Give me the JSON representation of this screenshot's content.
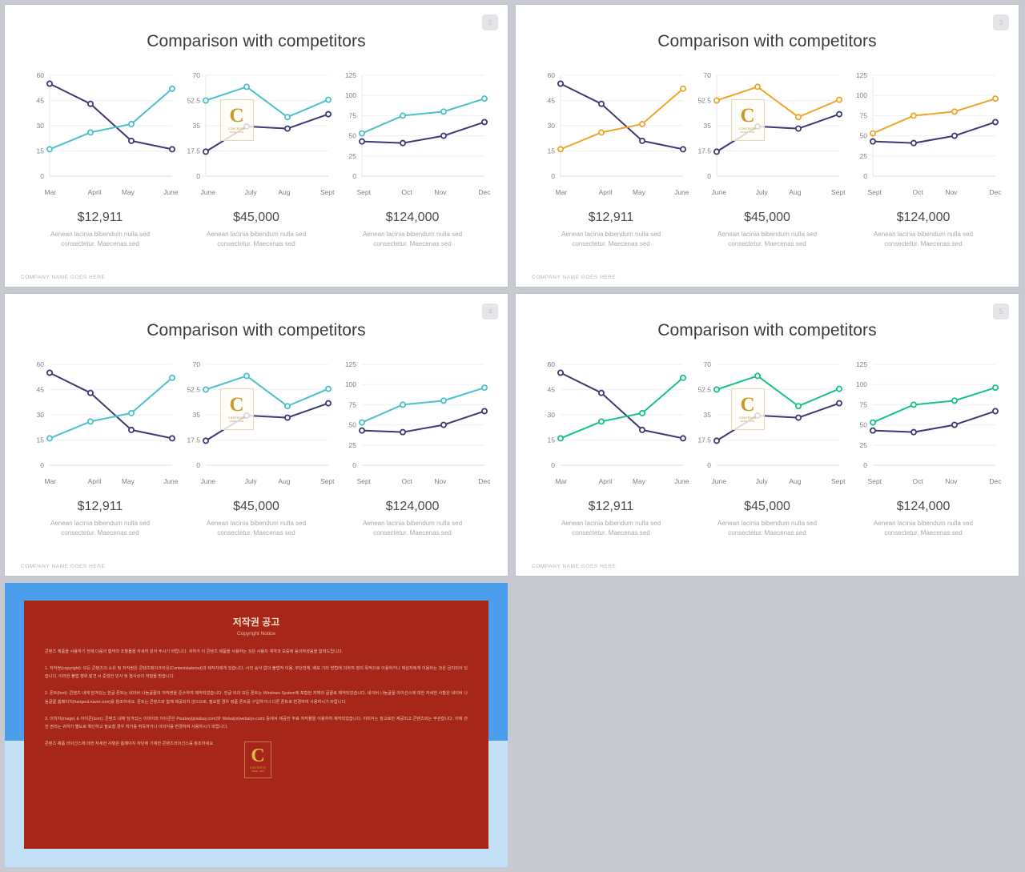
{
  "slides": [
    {
      "badge": "2",
      "title": "Comparison with competitors",
      "footer": "COMPANY NAME GOES HERE",
      "accent": "#4cc0cb",
      "base": "#3c3a74",
      "axis_line": true,
      "columns": [
        {
          "amount": "$12,911",
          "caption": "Aenean lacinia bibendum nulla sed consectetur. Maecenas sed"
        },
        {
          "amount": "$45,000",
          "caption": "Aenean lacinia bibendum nulla sed consectetur. Maecenas sed"
        },
        {
          "amount": "$124,000",
          "caption": "Aenean lacinia bibendum nulla sed consectetur. Maecenas sed"
        }
      ]
    },
    {
      "badge": "3",
      "title": "Comparison with competitors",
      "footer": "COMPANY NAME GOES HERE",
      "accent": "#efa52c",
      "base": "#3c3a74",
      "axis_line": true,
      "columns": [
        {
          "amount": "$12,911",
          "caption": "Aenean lacinia bibendum nulla sed consectetur. Maecenas sed"
        },
        {
          "amount": "$45,000",
          "caption": "Aenean lacinia bibendum nulla sed consectetur. Maecenas sed"
        },
        {
          "amount": "$124,000",
          "caption": "Aenean lacinia bibendum nulla sed consectetur. Maecenas sed"
        }
      ]
    },
    {
      "badge": "4",
      "title": "Comparison with competitors",
      "footer": "COMPANY NAME GOES HERE",
      "accent": "#4cc0cb",
      "base": "#3c3a74",
      "axis_line": false,
      "columns": [
        {
          "amount": "$12,911",
          "caption": "Aenean lacinia bibendum nulla sed consectetur. Maecenas sed"
        },
        {
          "amount": "$45,000",
          "caption": "Aenean lacinia bibendum nulla sed consectetur. Maecenas sed"
        },
        {
          "amount": "$124,000",
          "caption": "Aenean lacinia bibendum nulla sed consectetur. Maecenas sed"
        }
      ]
    },
    {
      "badge": "5",
      "title": "Comparison with competitors",
      "footer": "COMPANY NAME GOES HERE",
      "accent": "#16c47f",
      "base": "#3c3a74",
      "axis_line": false,
      "columns": [
        {
          "amount": "$12,911",
          "caption": "Aenean lacinia bibendum nulla sed consectetur. Maecenas sed"
        },
        {
          "amount": "$45,000",
          "caption": "Aenean lacinia bibendum nulla sed consectetur. Maecenas sed"
        },
        {
          "amount": "$124,000",
          "caption": "Aenean lacinia bibendum nulla sed consectetur. Maecenas sed"
        }
      ]
    }
  ],
  "watermark": {
    "letter": "C",
    "line1": "CONTENTS",
    "line2": "MADE . COM"
  },
  "copyright": {
    "title": "저작권 공고",
    "subtitle": "Copyright Notice",
    "paragraphs": [
      "콘텐츠 제품을 사용하기 전에 다음의 협약과 조항들을 자세히 읽어 주시기 바랍니다. 귀하가 이 콘텐츠 제품을 사용하는 것은 사용자 계약과 보증에 동의하셨음을 알려드립니다.",
      "1. 저작권(copyright): 모든 콘텐츠의 소유 및 저작권은 콘텐츠메이크아웃(Contentstakeout)과 제작자에게 있습니다. 사전 승낙 없이 불법적 이용, 무단전재, 배포 기타 방법에 의하여 영리 목적으로 이용하거나 제삼자에게 이용하는 것은 금지되어 있습니다. 이러한 불법 행위 발견 시 준엄한 민사 및 형사상의 처벌을 받습니다.",
      "2. 폰트(font): 콘텐츠 내에 담겨있는 한글 폰트는 네이버 나눔글꼴의 저작권을 준수하여 제작되었습니다. 한글 외의 모든 폰트는 Windows System에 포함된 자체의 글꼴로 제작되었습니다. 네이버 나눔글꼴 라이선스에 대한 자세한 사항은 네이버 나눔글꼴 홈페이지(hangeul.naver.com)를 참조하세요. 폰트는 콘텐츠와 함께 제공되지 않으므로, 필요할 경우 정품 폰트를 구입하거나 다른 폰트로 변경하여 사용하시기 바랍니다.",
      "3. 이미지(image) & 아이콘(icon): 콘텐츠 내에 담겨있는 이미지와 아이콘은 Pixabay(pixabay.com)와 Webalys(webalys.com) 등에서 제공한 무료 저작물을 이용하여 제작되었습니다. 이미지는 참고로만 제공되고 콘텐츠와는 무관합니다. 이에 관한 권리는 귀하가 별도로 확인하고 필요할 경우 허가를 취득하거나 이미지를 변경하여 사용하시기 바랍니다.",
      "콘텐츠 제품 라이선스에 대한 자세한 사항은 홈페이지 하단에 기재한 콘텐츠라이선스를 참조하세요."
    ],
    "frame_color_top": "#4a9eeb",
    "frame_color_bottom": "#c3e0f6",
    "panel_color": "#a6261a"
  },
  "chart_data": [
    {
      "type": "line",
      "title": "Comparison with competitors",
      "id": "chart-1",
      "categories": [
        "Mar",
        "April",
        "May",
        "June"
      ],
      "ylim": [
        0,
        60
      ],
      "yticks": [
        0,
        15,
        30,
        45,
        60
      ],
      "ytick_labels": [
        "0",
        "15",
        "30",
        "45",
        "60"
      ],
      "grid": true,
      "legend": "none",
      "xlabel": "",
      "ylabel": "",
      "series": [
        {
          "name": "base",
          "values": [
            55,
            43,
            21,
            16
          ]
        },
        {
          "name": "accent",
          "values": [
            16,
            26,
            31,
            52
          ]
        }
      ]
    },
    {
      "type": "line",
      "title": "Comparison with competitors",
      "id": "chart-2",
      "categories": [
        "June",
        "July",
        "Aug",
        "Sept"
      ],
      "ylim": [
        0,
        70
      ],
      "yticks": [
        0,
        17.5,
        35,
        52.5,
        70
      ],
      "ytick_labels": [
        "0",
        "17.5",
        "35",
        "52.5",
        "70"
      ],
      "grid": true,
      "legend": "none",
      "xlabel": "",
      "ylabel": "",
      "series": [
        {
          "name": "base",
          "values": [
            17,
            34.5,
            33,
            43
          ]
        },
        {
          "name": "accent",
          "values": [
            52.5,
            62,
            41,
            53
          ]
        }
      ]
    },
    {
      "type": "line",
      "title": "Comparison with competitors",
      "id": "chart-3",
      "categories": [
        "Sept",
        "Oct",
        "Nov",
        "Dec"
      ],
      "ylim": [
        0,
        125
      ],
      "yticks": [
        0,
        25,
        50,
        75,
        100,
        125
      ],
      "ytick_labels": [
        "0",
        "25",
        "50",
        "75",
        "100",
        "125"
      ],
      "grid": true,
      "legend": "none",
      "xlabel": "",
      "ylabel": "",
      "series": [
        {
          "name": "base",
          "values": [
            43,
            41,
            50,
            67
          ]
        },
        {
          "name": "accent",
          "values": [
            53,
            75,
            80,
            96
          ]
        }
      ]
    }
  ]
}
